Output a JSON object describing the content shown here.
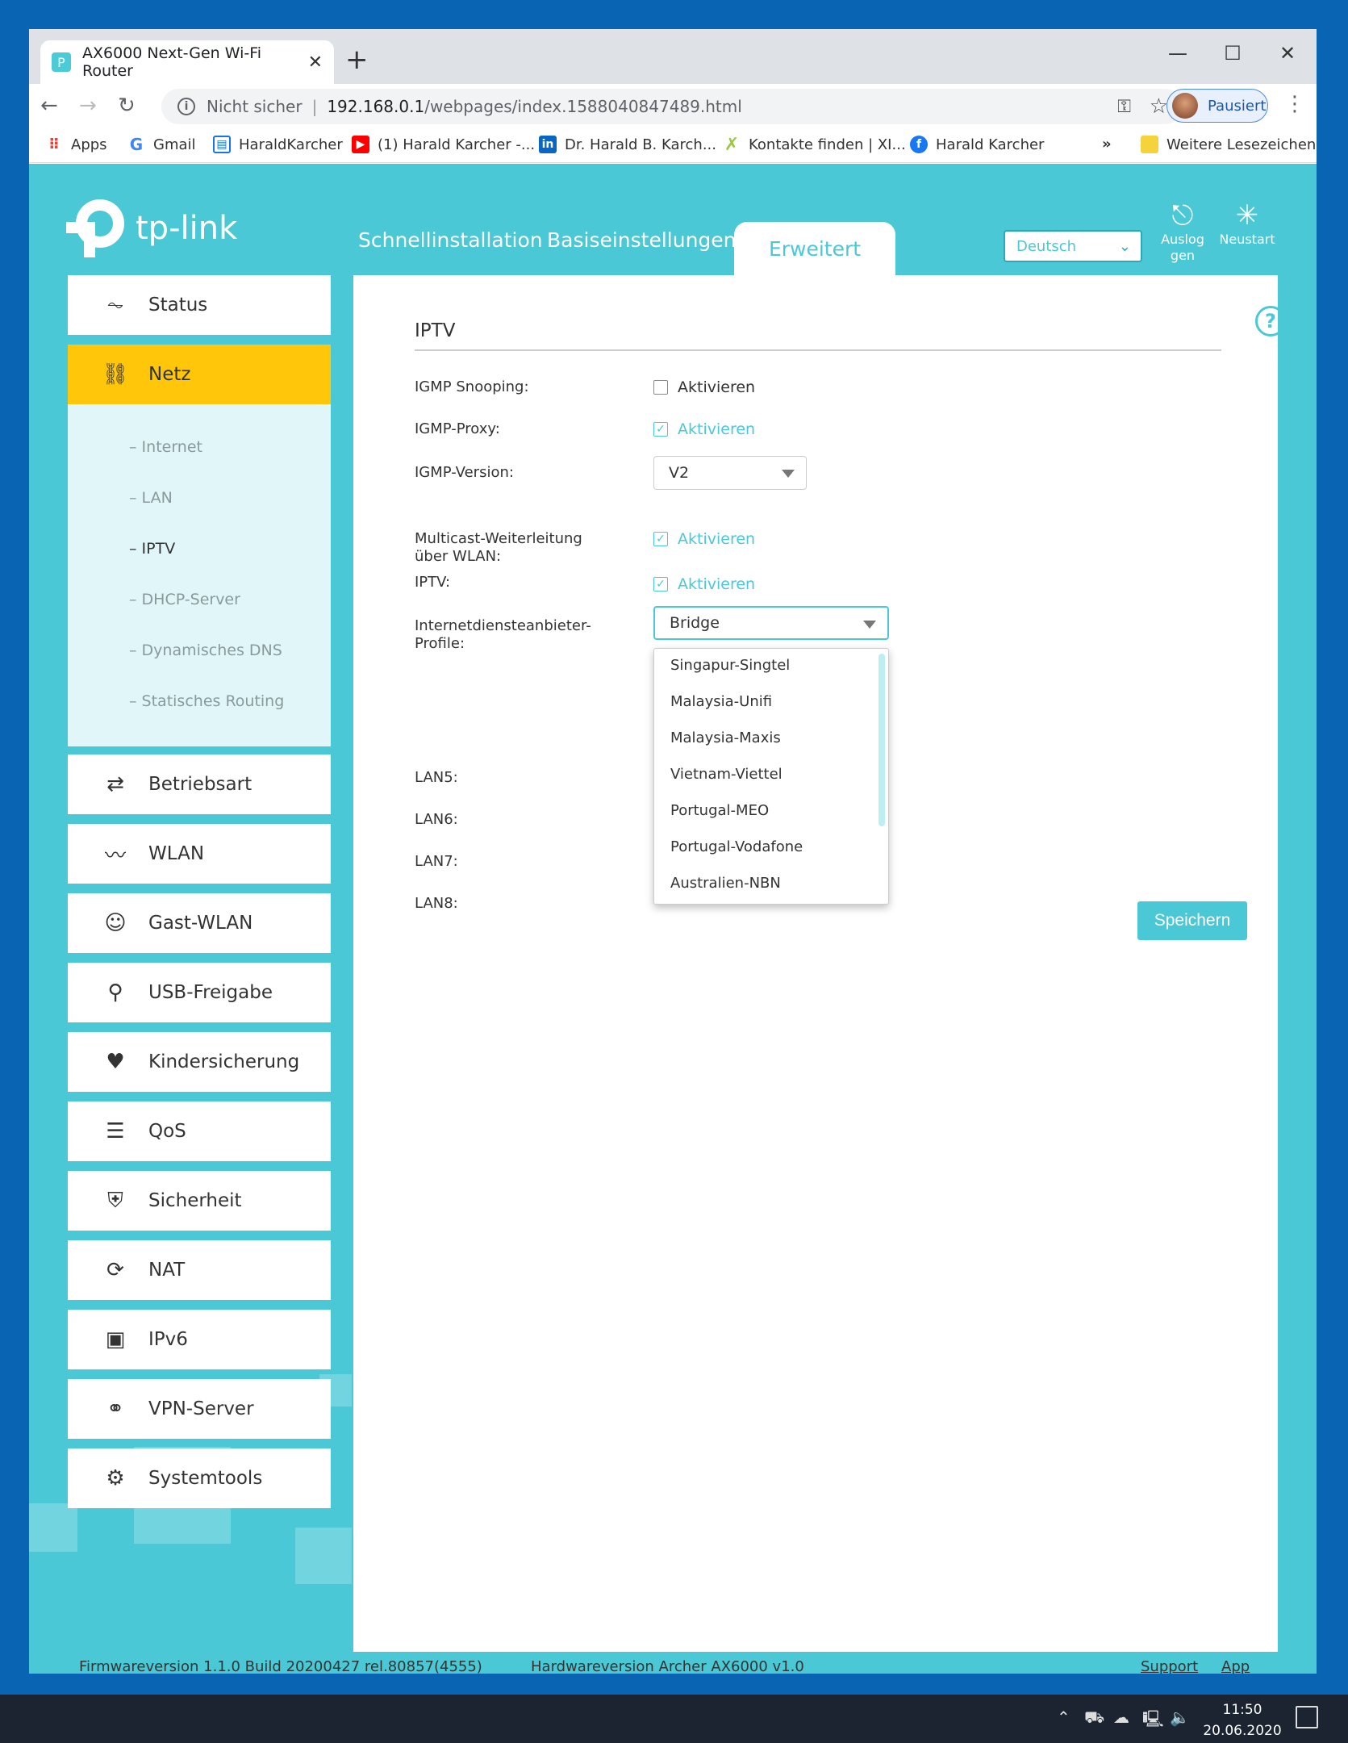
{
  "browser": {
    "tab_title": "AX6000 Next-Gen Wi-Fi Router",
    "tab_close": "✕",
    "new_tab": "+",
    "security": "Nicht sicher",
    "url_host": "192.168.0.1",
    "url_path": "/webpages/index.1588040847489.html",
    "profile_label": "Pausiert",
    "bookmarks": [
      {
        "label": "Apps",
        "color": "#e94235"
      },
      {
        "label": "Gmail",
        "color": "#4285f4"
      },
      {
        "label": "HaraldKarcher",
        "color": "#1a73e8"
      },
      {
        "label": "(1) Harald Karcher -...",
        "color": "#ff0000"
      },
      {
        "label": "Dr. Harald B. Karch...",
        "color": "#0a66c2"
      },
      {
        "label": "Kontakte finden | XI...",
        "color": "#9aca3c"
      },
      {
        "label": "Harald Karcher",
        "color": "#1877f2"
      }
    ],
    "more_bookmarks": "»",
    "other_bookmarks": "Weitere Lesezeichen"
  },
  "router": {
    "logo_text": "tp-link",
    "nav": [
      "Schnellinstallation",
      "Basiseinstellungen",
      "Erweitert"
    ],
    "language": "Deutsch",
    "logout_label": "Ausloggen",
    "reboot_label": "Neustart",
    "sidebar": [
      {
        "label": "Status",
        "icon": "pulse-icon"
      },
      {
        "label": "Netz",
        "icon": "network-icon"
      },
      {
        "label": "Betriebsart",
        "icon": "mode-icon"
      },
      {
        "label": "WLAN",
        "icon": "wifi-icon"
      },
      {
        "label": "Gast-WLAN",
        "icon": "guest-icon"
      },
      {
        "label": "USB-Freigabe",
        "icon": "usb-icon"
      },
      {
        "label": "Kindersicherung",
        "icon": "parental-icon"
      },
      {
        "label": "QoS",
        "icon": "qos-icon"
      },
      {
        "label": "Sicherheit",
        "icon": "shield-icon"
      },
      {
        "label": "NAT",
        "icon": "nat-icon"
      },
      {
        "label": "IPv6",
        "icon": "ipv6-icon"
      },
      {
        "label": "VPN-Server",
        "icon": "vpn-icon"
      },
      {
        "label": "Systemtools",
        "icon": "gear-icon"
      }
    ],
    "subnav": [
      "Internet",
      "LAN",
      "IPTV",
      "DHCP-Server",
      "Dynamisches DNS",
      "Statisches Routing"
    ],
    "section_title": "IPTV",
    "form": {
      "igmp_snooping_label": "IGMP Snooping:",
      "igmp_proxy_label": "IGMP-Proxy:",
      "igmp_version_label": "IGMP-Version:",
      "igmp_version_value": "V2",
      "multicast_label": "Multicast-Weiterleitung über WLAN:",
      "iptv_label": "IPTV:",
      "isp_label": "Internetdiensteanbieter-Profile:",
      "isp_value": "Bridge",
      "enable_text": "Aktivieren",
      "check_mark": "✓",
      "lan5": "LAN5:",
      "lan6": "LAN6:",
      "lan7": "LAN7:",
      "lan8": "LAN8:"
    },
    "isp_options": [
      "Singapur-Singtel",
      "Malaysia-Unifi",
      "Malaysia-Maxis",
      "Vietnam-Viettel",
      "Portugal-MEO",
      "Portugal-Vodafone",
      "Australien-NBN"
    ],
    "save_label": "Speichern",
    "footer": {
      "firmware": "Firmwareversion 1.1.0 Build 20200427 rel.80857(4555)",
      "hardware": "Hardwareversion Archer AX6000 v1.0",
      "support": "Support",
      "app": "App"
    }
  },
  "taskbar": {
    "time": "11:50",
    "date": "20.06.2020"
  }
}
